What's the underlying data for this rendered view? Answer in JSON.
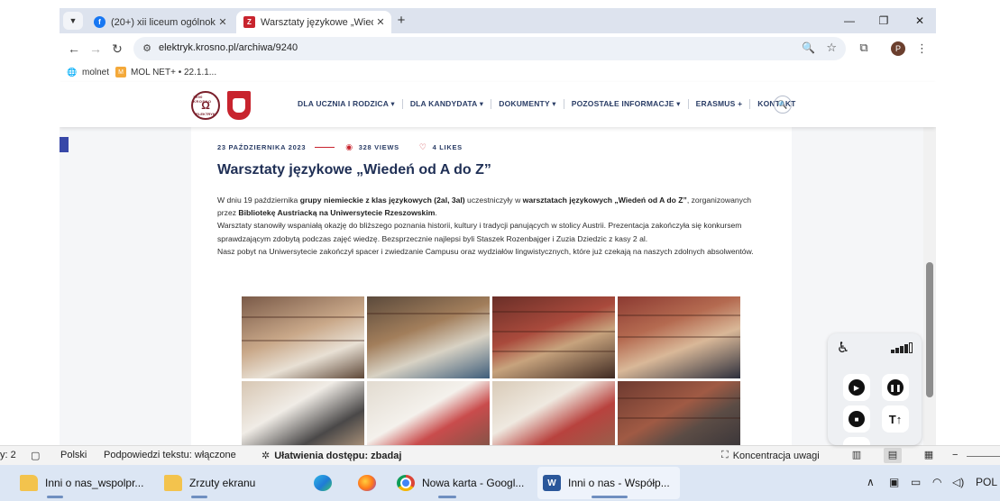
{
  "browser": {
    "tabs": [
      {
        "title": "(20+) xii liceum ogólnokształcą",
        "favicon": "facebook-icon",
        "active": false
      },
      {
        "title": "Warsztaty językowe „Wiedeń od",
        "favicon": "ze-icon",
        "active": true
      }
    ],
    "new_tab_label": "+",
    "url": "elektryk.krosno.pl/archiwa/9240",
    "bookmarks": [
      {
        "label": "molnet",
        "icon": "globe-icon"
      },
      {
        "label": "MOL NET+ • 22.1.1...",
        "icon": "molnet-icon"
      }
    ],
    "profile_initial": "P"
  },
  "site": {
    "logo_top": "1950 KROSNO",
    "logo_bottom": "ELEKTRYK",
    "nav": [
      {
        "label": "DLA UCZNIA I RODZICA",
        "has_dropdown": true
      },
      {
        "label": "DLA KANDYDATA",
        "has_dropdown": true
      },
      {
        "label": "DOKUMENTY",
        "has_dropdown": true
      },
      {
        "label": "POZOSTAŁE INFORMACJE",
        "has_dropdown": true
      },
      {
        "label": "ERASMUS +",
        "has_dropdown": false
      },
      {
        "label": "KONTAKT",
        "has_dropdown": false
      }
    ]
  },
  "article": {
    "date": "23 PAŹDZIERNIKA 2023",
    "views": "328 VIEWS",
    "likes": "4 LIKES",
    "title": "Warsztaty językowe „Wiedeń od A do Z”",
    "p1_a": "W dniu 19 października ",
    "p1_b": "grupy niemieckie z klas językowych (2al, 3al)",
    "p1_c": " uczestniczyły w ",
    "p1_d": "warsztatach językowych „Wiedeń od A do Z”",
    "p1_e": ", zorganizowanych przez ",
    "p1_f": "Bibliotekę Austriacką na Uniwersytecie Rzeszowskim",
    "p1_g": ".",
    "p2": "Warsztaty stanowiły wspaniałą okazję do bliższego poznania historii, kultury i tradycji panujących w stolicy Austrii. Prezentacja zakończyła się konkursem sprawdzającym zdobytą podczas zajęć wiedzę. Bezsprzecznie najlepsi byli Staszek Rozenbajger i Zuzia Dziedzic z kasy 2 al.",
    "p3": "Nasz pobyt na Uniwersytecie zakończył spacer i zwiedzanie Campusu oraz wydziałów lingwistycznych, które już czekają na naszych zdolnych absolwentów.",
    "photo_count": 8
  },
  "word_status": {
    "page_fragment": "y: 2",
    "language": "Polski",
    "suggestions": "Podpowiedzi tekstu: włączone",
    "accessibility": "Ułatwienia dostępu: zbadaj",
    "focus": "Koncentracja uwagi",
    "zoom_minus": "−"
  },
  "taskbar": {
    "apps": [
      {
        "label": "Inni o nas_wspolpr...",
        "icon": "folder-icon"
      },
      {
        "label": "Zrzuty ekranu",
        "icon": "folder-icon"
      },
      {
        "label": "",
        "icon": "edge-icon"
      },
      {
        "label": "",
        "icon": "firefox-icon"
      },
      {
        "label": "Nowa karta - Googl...",
        "icon": "chrome-icon"
      },
      {
        "label": "Inni o nas - Współp...",
        "icon": "word-icon"
      }
    ],
    "language": "POL"
  }
}
